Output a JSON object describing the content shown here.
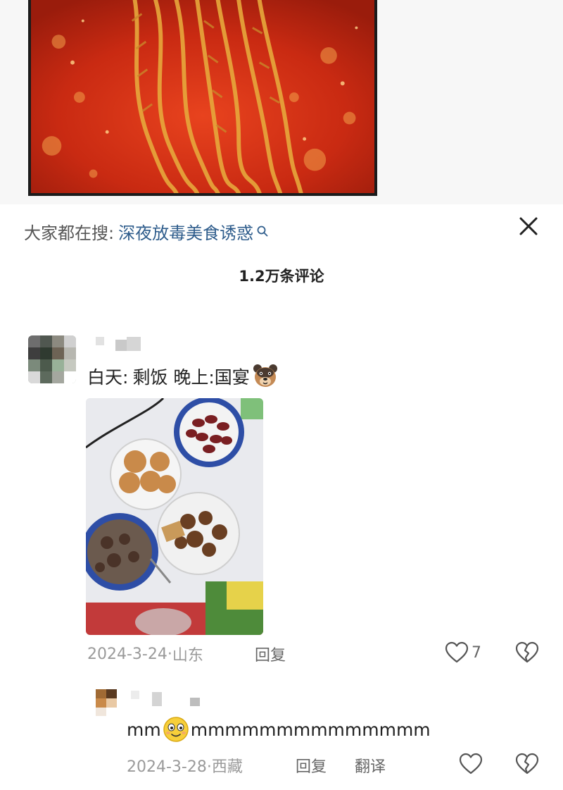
{
  "search": {
    "prefix": "大家都在搜:",
    "term": "深夜放毒美食诱惑",
    "search_icon": "search-icon",
    "close_icon": "close-icon"
  },
  "comments_header": {
    "count_label": "1.2万条评论"
  },
  "comments": [
    {
      "text_day": "白天:",
      "text_rest": "剩饭 晚上:国宴",
      "emoji": "dog-face-emoji",
      "date": "2024-3-24",
      "separator": "·",
      "location": "山东",
      "reply_label": "回复",
      "likes": "7",
      "replies": [
        {
          "text_before": "mm",
          "emoji": "smiling-face-emoji",
          "text_after": "mmmmmmmmmmmmmm",
          "date": "2024-3-28",
          "separator": "·",
          "location": "西藏",
          "reply_label": "回复",
          "translate_label": "翻译"
        }
      ]
    }
  ],
  "colors": {
    "link": "#2f5d8c",
    "meta": "#9a9a9a",
    "text": "#222222"
  }
}
